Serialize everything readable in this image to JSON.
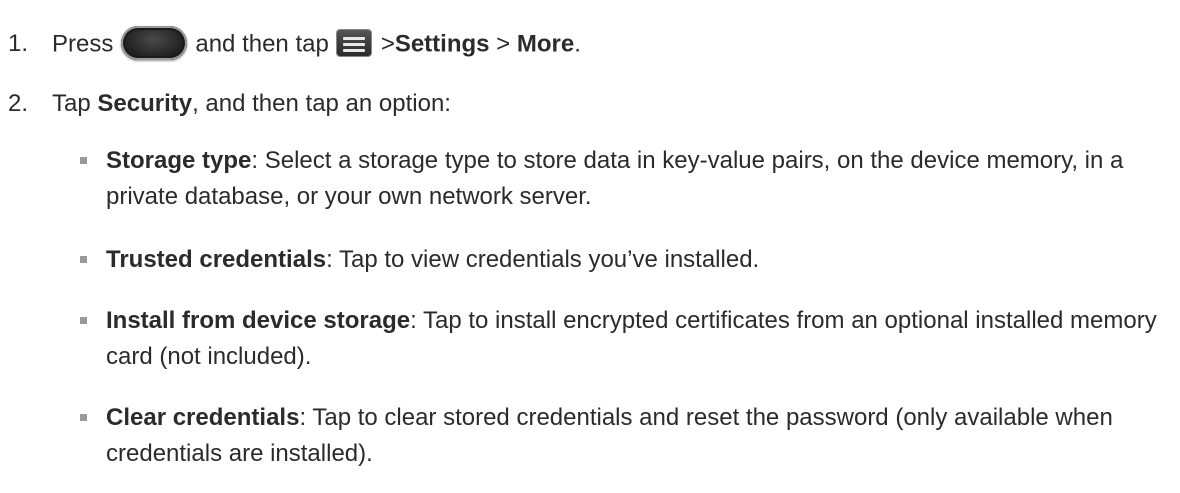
{
  "steps": [
    {
      "number": "1.",
      "text_before": "Press",
      "text_middle": "and then tap",
      "text_after": ">",
      "settings_label": "Settings",
      "separator": " > ",
      "more_label": "More",
      "end": ".",
      "icons": [
        "home-key-icon",
        "menu-icon"
      ]
    },
    {
      "number": "2.",
      "text_before": "Tap ",
      "security_label": "Security",
      "text_after": ", and then tap an option:"
    }
  ],
  "options": [
    {
      "term": "Storage type",
      "description": ": Select a storage type to store data in key-value pairs, on the device memory, in a private database, or your own network server."
    },
    {
      "term": "Trusted credentials",
      "description": ": Tap to view credentials you’ve installed."
    },
    {
      "term": "Install from device storage",
      "description": ": Tap to install encrypted certificates from an optional installed memory card (not included)."
    },
    {
      "term": "Clear credentials",
      "description": ": Tap to clear stored credentials and reset the password (only available when credentials are installed)."
    }
  ]
}
